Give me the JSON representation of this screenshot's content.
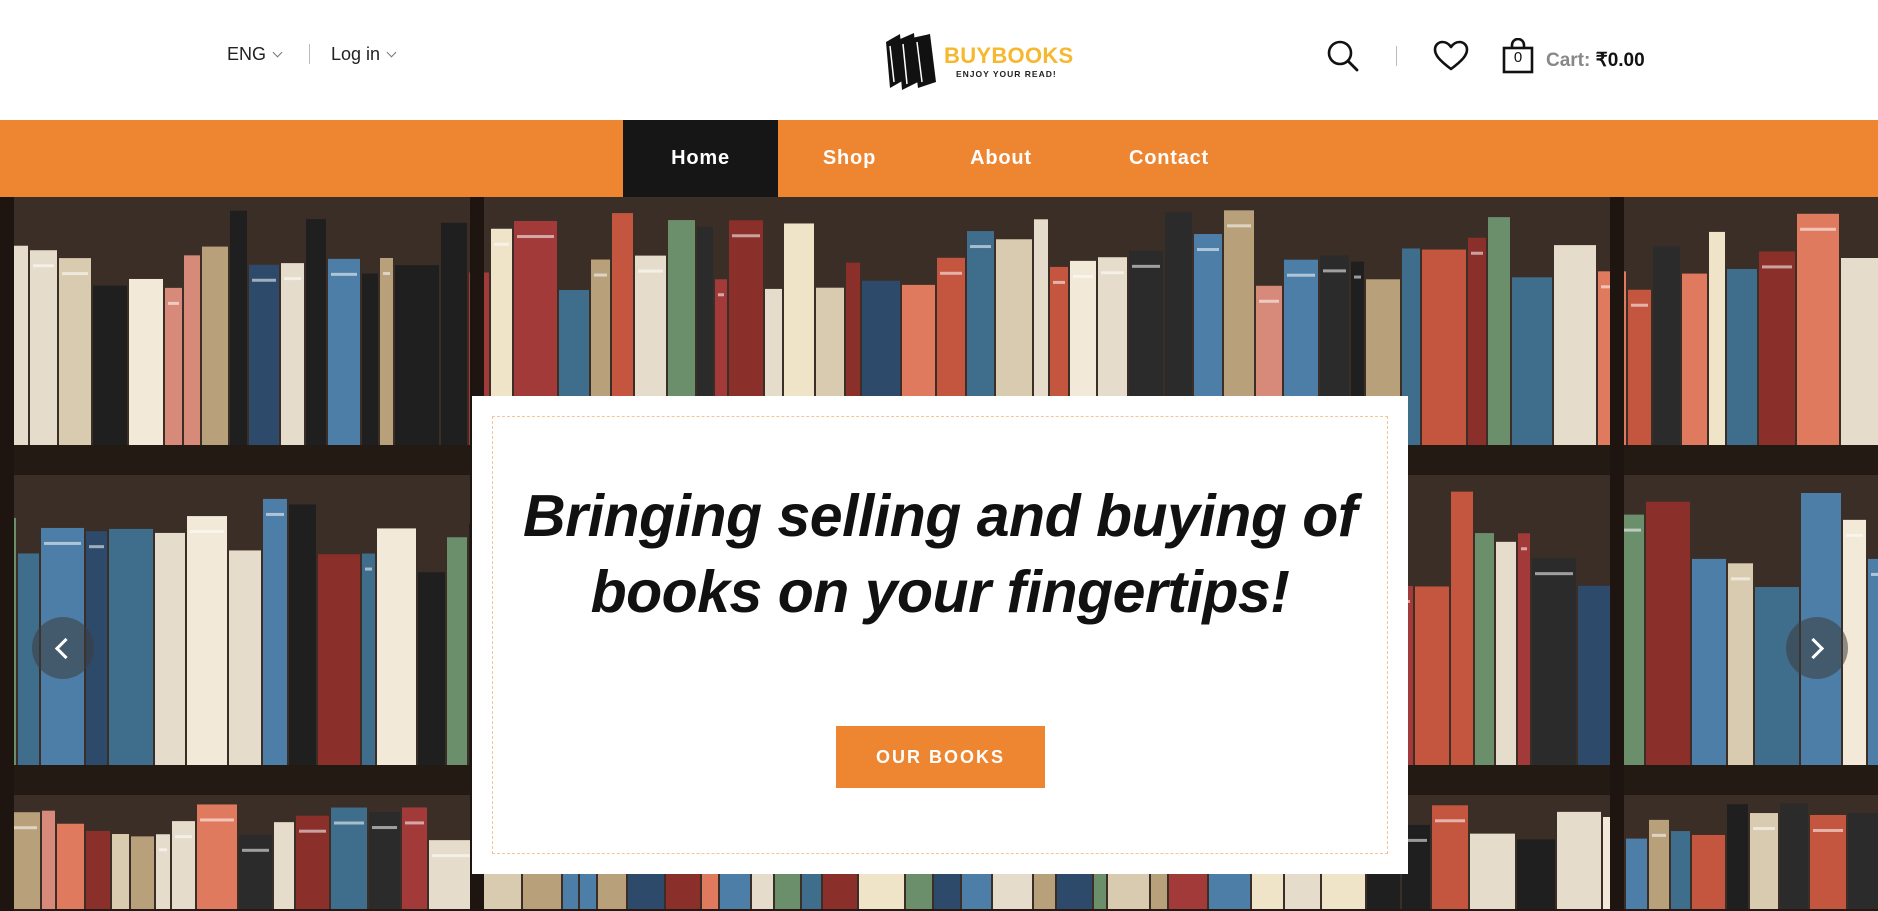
{
  "header": {
    "language": "ENG",
    "login_label": "Log in",
    "logo": {
      "name": "BUYBOOKS",
      "tagline": "ENJOY YOUR READ!"
    },
    "cart": {
      "count": "0",
      "label": "Cart:",
      "total": "₹0.00"
    }
  },
  "nav": {
    "items": [
      {
        "label": "Home",
        "active": true
      },
      {
        "label": "Shop",
        "active": false
      },
      {
        "label": "About",
        "active": false
      },
      {
        "label": "Contact",
        "active": false
      }
    ]
  },
  "hero": {
    "headline": "Bringing selling and buying of books on your fingertips!",
    "cta_label": "OUR BOOKS"
  },
  "colors": {
    "accent": "#ee8530",
    "nav_active": "#161616",
    "logo": "#f5b82e"
  },
  "icons": [
    "chevron-down-icon",
    "books-logo-icon",
    "search-icon",
    "heart-icon",
    "shopping-bag-icon",
    "chevron-left-icon",
    "chevron-right-icon"
  ]
}
